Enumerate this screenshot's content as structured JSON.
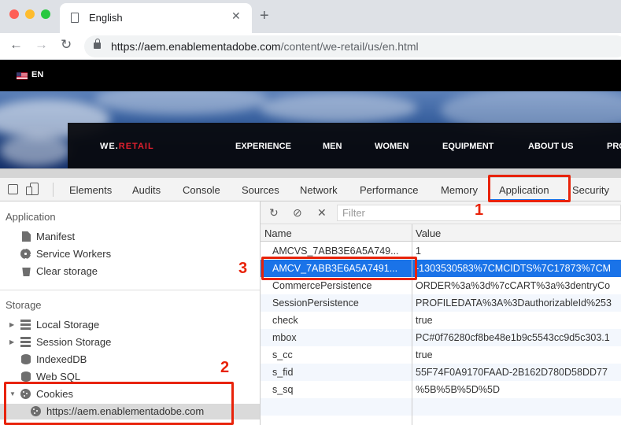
{
  "browser": {
    "tab_title": "English",
    "new_tab_label": "+",
    "close_label": "✕",
    "url_host": "https://aem.enablementadobe.com",
    "url_path": "/content/we-retail/us/en.html",
    "nav_back": "←",
    "nav_forward": "→",
    "nav_reload": "↻",
    "traffic_colors": [
      "#fe5f57",
      "#febc2e",
      "#28c840"
    ]
  },
  "site": {
    "language": "EN",
    "brand_prefix": "WE.",
    "brand_suffix": "RETAIL",
    "nav": [
      "EXPERIENCE",
      "MEN",
      "WOMEN",
      "EQUIPMENT",
      "ABOUT US",
      "PRO"
    ]
  },
  "devtools": {
    "tabs": [
      "Elements",
      "Audits",
      "Console",
      "Sources",
      "Network",
      "Performance",
      "Memory",
      "Application",
      "Security"
    ],
    "active_tab": "Application",
    "sidebar": {
      "application_header": "Application",
      "application_items": [
        {
          "label": "Manifest",
          "icon": "manifest-icon"
        },
        {
          "label": "Service Workers",
          "icon": "gear-icon"
        },
        {
          "label": "Clear storage",
          "icon": "trash-icon"
        }
      ],
      "storage_header": "Storage",
      "storage_items": [
        {
          "label": "Local Storage",
          "icon": "grid-icon"
        },
        {
          "label": "Session Storage",
          "icon": "grid-icon"
        },
        {
          "label": "IndexedDB",
          "icon": "database-icon"
        },
        {
          "label": "Web SQL",
          "icon": "database-icon"
        },
        {
          "label": "Cookies",
          "icon": "cookie-icon"
        }
      ],
      "cookie_origin": "https://aem.enablementadobe.com"
    },
    "cookies": {
      "filter_placeholder": "Filter",
      "refresh_icon": "↻",
      "clear_icon": "⊘",
      "delete_icon": "✕",
      "columns": [
        "Name",
        "Value"
      ],
      "rows": [
        {
          "name": "AMCVS_7ABB3E6A5A749...",
          "value": "1"
        },
        {
          "name": "AMCV_7ABB3E6A5A7491...",
          "value": "-1303530583%7CMCIDTS%7C17873%7CM"
        },
        {
          "name": "CommercePersistence",
          "value": "ORDER%3a%3d%7cCART%3a%3dentryCo"
        },
        {
          "name": "SessionPersistence",
          "value": "PROFILEDATA%3A%3DauthorizableId%253"
        },
        {
          "name": "check",
          "value": "true"
        },
        {
          "name": "mbox",
          "value": "PC#0f76280cf8be48e1b9c5543cc9d5c303.1"
        },
        {
          "name": "s_cc",
          "value": "true"
        },
        {
          "name": "s_fid",
          "value": "55F74F0A9170FAAD-2B162D780D58DD77"
        },
        {
          "name": "s_sq",
          "value": "%5B%5B%5D%5D"
        }
      ],
      "selected_row": 1
    }
  },
  "annotations": {
    "labels": [
      "1",
      "2",
      "3"
    ],
    "color": "#e8230a"
  }
}
